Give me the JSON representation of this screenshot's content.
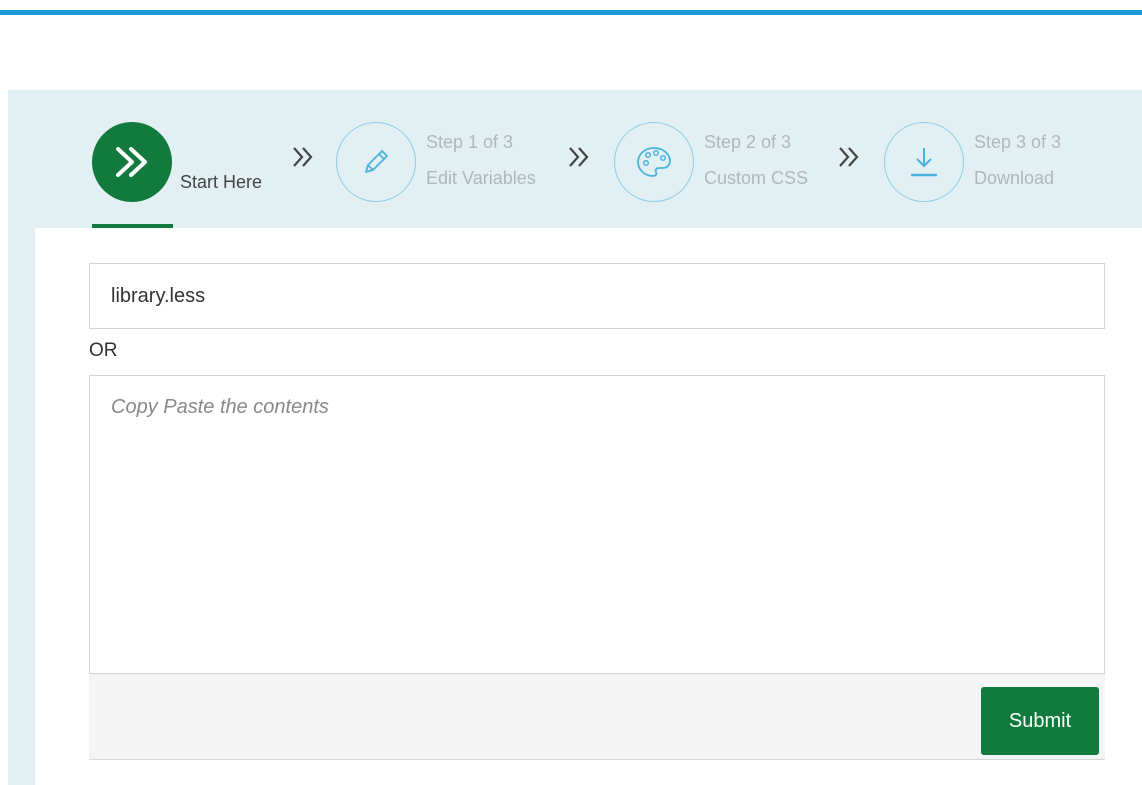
{
  "stepper": {
    "steps": [
      {
        "id": "start",
        "label": "Start Here",
        "icon": "double-chevron-right-icon",
        "active": true
      },
      {
        "id": "edit",
        "number": "Step 1 of 3",
        "label": "Edit Variables",
        "icon": "pencil-icon",
        "active": false
      },
      {
        "id": "css",
        "number": "Step 2 of 3",
        "label": "Custom CSS",
        "icon": "palette-icon",
        "active": false
      },
      {
        "id": "download",
        "number": "Step 3 of 3",
        "label": "Download",
        "icon": "download-icon",
        "active": false
      }
    ],
    "separator_icon": "double-chevron-icon"
  },
  "form": {
    "file_value": "library.less",
    "or_label": "OR",
    "paste_placeholder": "Copy Paste the contents",
    "submit_label": "Submit"
  },
  "colors": {
    "accent_top_bar": "#1a9ad6",
    "primary_green": "#117a3c",
    "panel_bg": "#e2f0f4",
    "inactive_circle_border": "#8ccde6",
    "inactive_text": "#aeb7bb"
  }
}
